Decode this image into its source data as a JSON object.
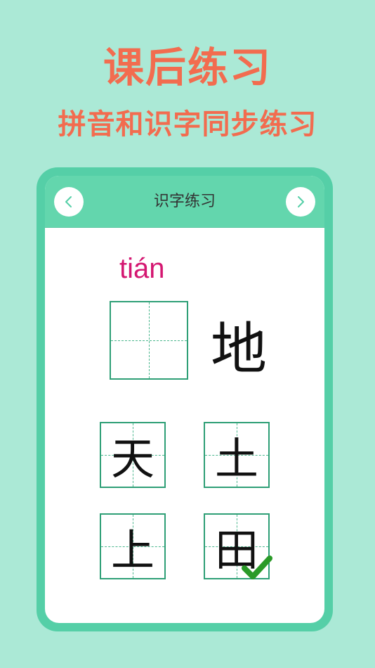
{
  "promo": {
    "title": "课后练习",
    "subtitle": "拼音和识字同步练习"
  },
  "card": {
    "header_title": "识字练习",
    "prev_icon": "chevron-left-icon",
    "next_icon": "chevron-right-icon"
  },
  "question": {
    "pinyin": "tián",
    "answer_box": "",
    "prompt_char": "地"
  },
  "options": [
    {
      "char": "天",
      "selected": false
    },
    {
      "char": "土",
      "selected": false
    },
    {
      "char": "上",
      "selected": false
    },
    {
      "char": "田",
      "selected": true
    }
  ],
  "colors": {
    "background": "#abe9d6",
    "accent": "#f26c4f",
    "card_border": "#55cfa7",
    "pinyin": "#d41771",
    "grid": "#2e9f76",
    "check": "#2a9a28"
  }
}
